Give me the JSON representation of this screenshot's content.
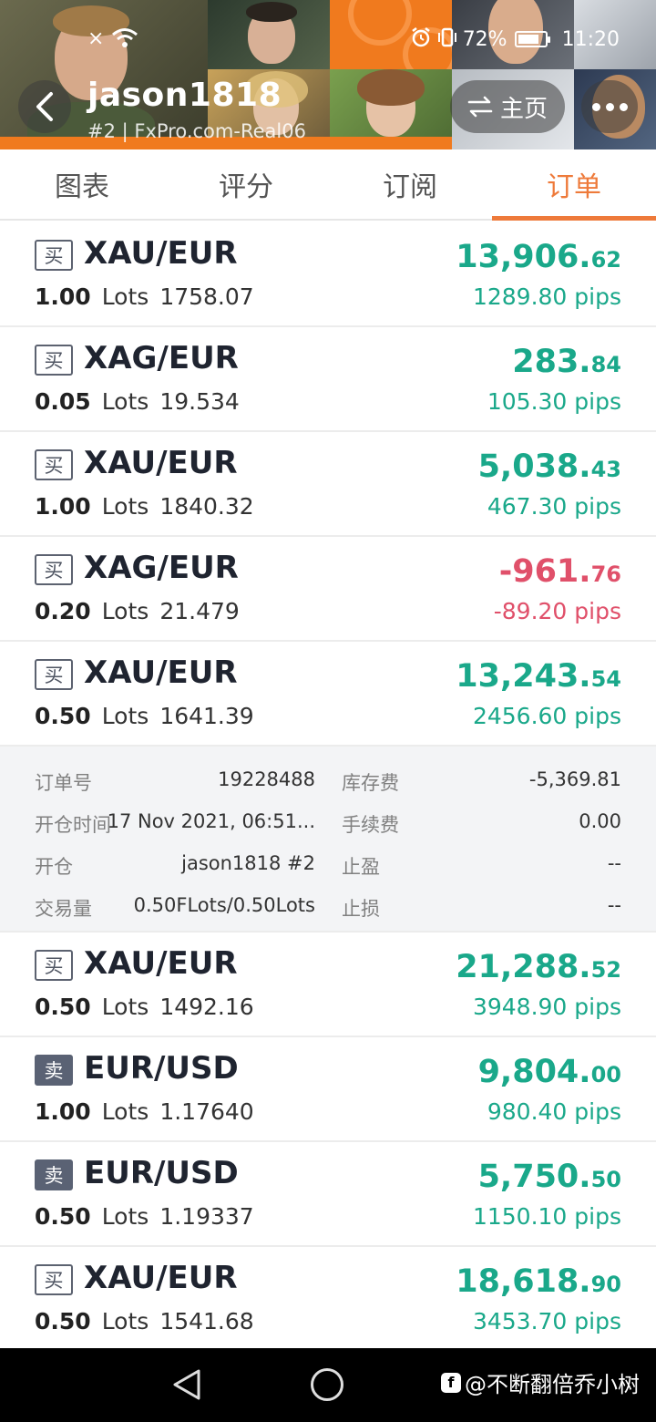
{
  "status_bar": {
    "notification_close": "×",
    "battery_percent": "72%",
    "time": "11:20"
  },
  "header": {
    "username": "jason1818",
    "account": "#2 | FxPro.com-Real06",
    "home_label": "主页"
  },
  "tabs": [
    {
      "label": "图表"
    },
    {
      "label": "评分"
    },
    {
      "label": "订阅"
    },
    {
      "label": "订单"
    }
  ],
  "colors": {
    "accent": "#ee7a3a",
    "profit_positive": "#1aa88a",
    "profit_negative": "#e0506a"
  },
  "orders": [
    {
      "side": "买",
      "symbol": "XAU/EUR",
      "lots": "1.00",
      "lots_unit": "Lots",
      "price": "1758.07",
      "profit_int": "13,906.",
      "profit_dec": "62",
      "pips": "1289.80 pips"
    },
    {
      "side": "买",
      "symbol": "XAG/EUR",
      "lots": "0.05",
      "lots_unit": "Lots",
      "price": "19.534",
      "profit_int": "283.",
      "profit_dec": "84",
      "pips": "105.30 pips"
    },
    {
      "side": "买",
      "symbol": "XAU/EUR",
      "lots": "1.00",
      "lots_unit": "Lots",
      "price": "1840.32",
      "profit_int": "5,038.",
      "profit_dec": "43",
      "pips": "467.30 pips"
    },
    {
      "side": "买",
      "symbol": "XAG/EUR",
      "lots": "0.20",
      "lots_unit": "Lots",
      "price": "21.479",
      "profit_int": "-961.",
      "profit_dec": "76",
      "pips": "-89.20 pips"
    },
    {
      "side": "买",
      "symbol": "XAU/EUR",
      "lots": "0.50",
      "lots_unit": "Lots",
      "price": "1641.39",
      "profit_int": "13,243.",
      "profit_dec": "54",
      "pips": "2456.60 pips"
    },
    {
      "side": "买",
      "symbol": "XAU/EUR",
      "lots": "0.50",
      "lots_unit": "Lots",
      "price": "1492.16",
      "profit_int": "21,288.",
      "profit_dec": "52",
      "pips": "3948.90 pips"
    },
    {
      "side": "卖",
      "symbol": "EUR/USD",
      "lots": "1.00",
      "lots_unit": "Lots",
      "price": "1.17640",
      "profit_int": "9,804.",
      "profit_dec": "00",
      "pips": "980.40 pips"
    },
    {
      "side": "卖",
      "symbol": "EUR/USD",
      "lots": "0.50",
      "lots_unit": "Lots",
      "price": "1.19337",
      "profit_int": "5,750.",
      "profit_dec": "50",
      "pips": "1150.10 pips"
    },
    {
      "side": "买",
      "symbol": "XAU/EUR",
      "lots": "0.50",
      "lots_unit": "Lots",
      "price": "1541.68",
      "profit_int": "18,618.",
      "profit_dec": "90",
      "pips": "3453.70 pips"
    }
  ],
  "order_details": {
    "order_no_label": "订单号",
    "order_no": "19228488",
    "swap_label": "库存费",
    "swap": "-5,369.81",
    "open_time_label": "开仓时间",
    "open_time": "17 Nov 2021, 06:51...",
    "commission_label": "手续费",
    "commission": "0.00",
    "open_by_label": "开仓",
    "open_by": "jason1818  #2",
    "take_profit_label": "止盈",
    "take_profit": "--",
    "volume_label": "交易量",
    "volume": "0.50FLots/0.50Lots",
    "stop_loss_label": "止损",
    "stop_loss": "--"
  },
  "watermark": {
    "logo": "f",
    "text": "@不断翻倍乔小树"
  }
}
